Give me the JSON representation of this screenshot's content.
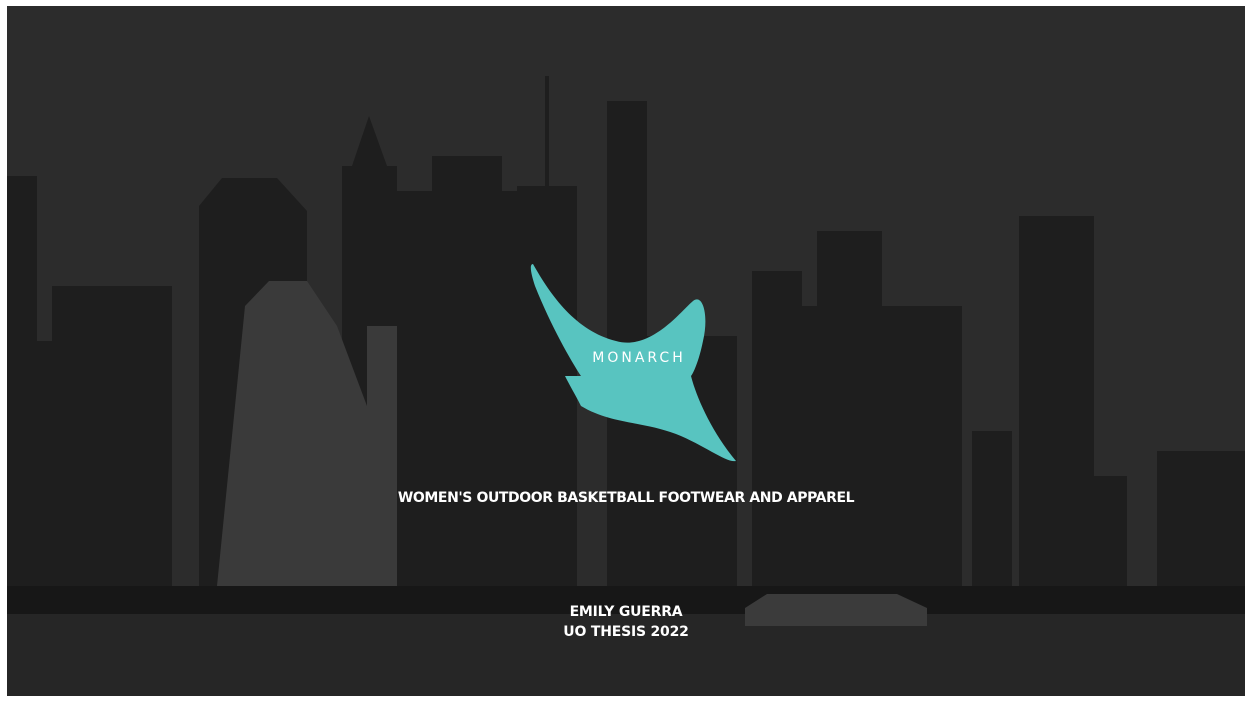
{
  "logo": {
    "wordmark": "MONARCH",
    "color": "#58c4c0"
  },
  "tagline": "WOMEN'S OUTDOOR BASKETBALL FOOTWEAR AND APPAREL",
  "author": "EMILY GUERRA",
  "thesis": "UO THESIS 2022",
  "colors": {
    "background": "#2b2b2b",
    "accent": "#58c4c0",
    "text": "#ffffff"
  }
}
